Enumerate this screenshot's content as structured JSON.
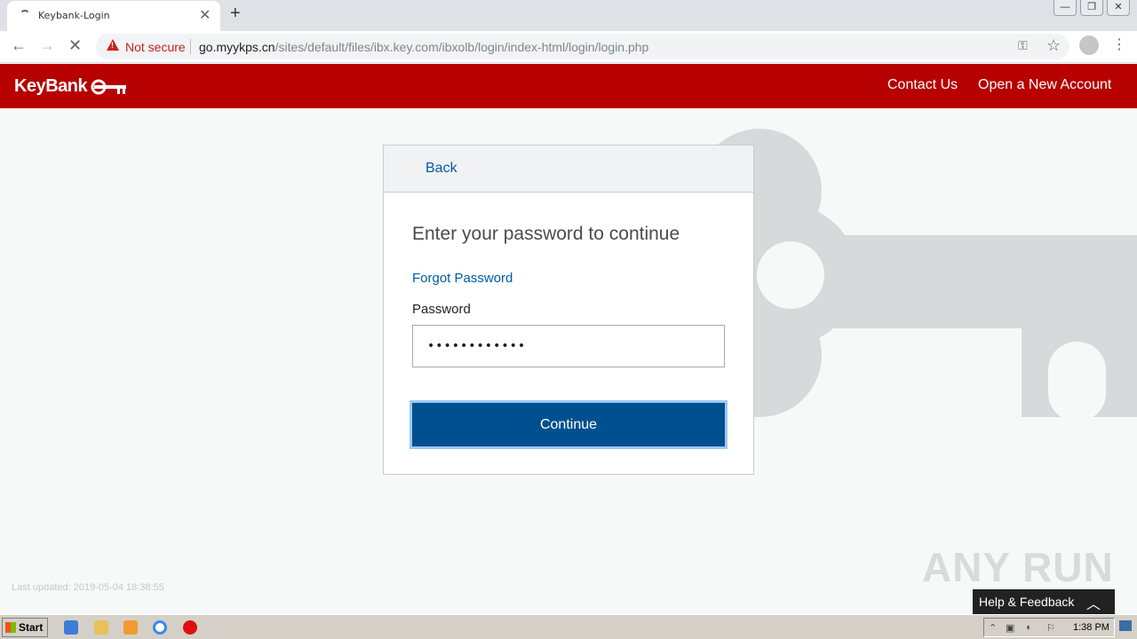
{
  "browser": {
    "tab_title": "Keybank-Login",
    "security_label": "Not secure",
    "url_host": "go.myykps.cn",
    "url_path": "/sites/default/files/ibx.key.com/ibxolb/login/index-html/login/login.php"
  },
  "header": {
    "logo_text": "KeyBank",
    "links": [
      "Contact Us",
      "Open a New Account"
    ],
    "brand_color": "#b70000"
  },
  "card": {
    "back_label": "Back",
    "title": "Enter your password to continue",
    "forgot_label": "Forgot Password",
    "password_label": "Password",
    "password_value": "••••••••••••",
    "continue_label": "Continue"
  },
  "footer": {
    "last_updated": "Last updated: 2019-05-04 18:38:55",
    "help_label": "Help & Feedback"
  },
  "watermark": "ANY RUN",
  "taskbar": {
    "start_label": "Start",
    "time": "1:38 PM"
  }
}
